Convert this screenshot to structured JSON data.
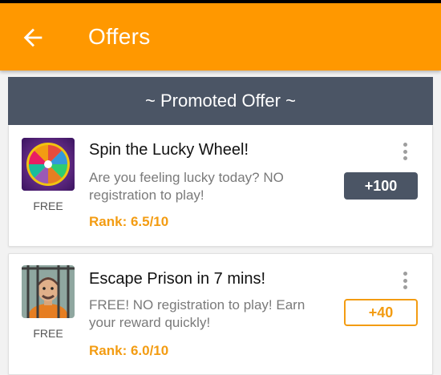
{
  "appbar": {
    "title": "Offers",
    "back_icon": "arrow-left-icon",
    "color": "#ff9800"
  },
  "promo_header": {
    "text": "~ Promoted Offer ~",
    "color": "#4b5565"
  },
  "offers": [
    {
      "title": "Spin the Lucky Wheel!",
      "description": "Are you feeling lucky today?  NO registration to play!",
      "price_label": "FREE",
      "rank": "Rank: 6.5/10",
      "reward": "+100",
      "icon": "lucky-wheel-icon",
      "reward_style": "filled"
    },
    {
      "title": "Escape Prison in 7 mins!",
      "description": "FREE! NO registration to play! Earn your reward quickly!",
      "price_label": "FREE",
      "rank": "Rank: 6.0/10",
      "reward": "+40",
      "icon": "prisoner-icon",
      "reward_style": "outline"
    }
  ],
  "colors": {
    "accent": "#f39c12",
    "header_dark": "#4b5565"
  }
}
